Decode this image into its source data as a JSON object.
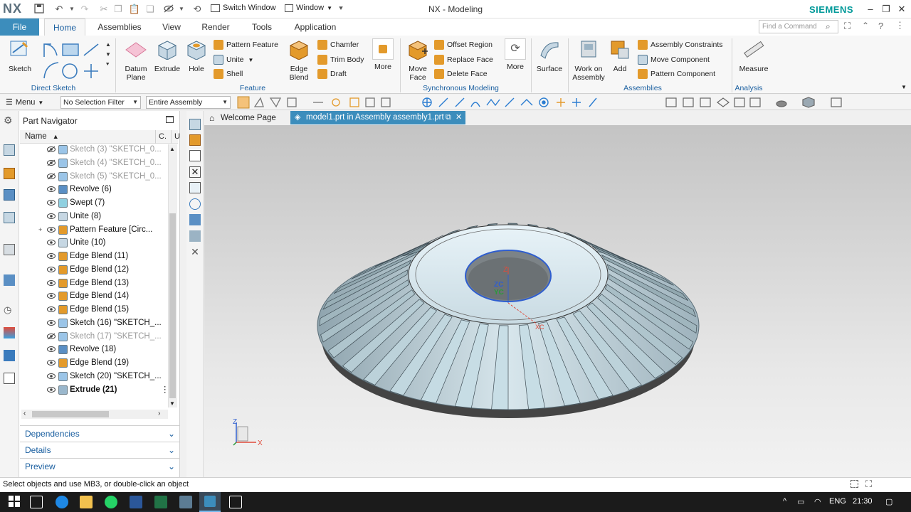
{
  "titlebar": {
    "logo": "NX",
    "switch_window": "Switch Window",
    "window_menu": "Window",
    "app_title": "NX - Modeling",
    "brand": "SIEMENS"
  },
  "ribbon_tabs": [
    "File",
    "Home",
    "Assemblies",
    "View",
    "Render",
    "Tools",
    "Application"
  ],
  "search": {
    "placeholder": "Find a Command"
  },
  "ribbon": {
    "direct_sketch": {
      "label": "Direct Sketch",
      "sketch": "Sketch"
    },
    "feature": {
      "label": "Feature",
      "datum_plane": "Datum Plane",
      "extrude": "Extrude",
      "hole": "Hole",
      "pattern_feature": "Pattern Feature",
      "unite": "Unite",
      "shell": "Shell",
      "edge_blend": "Edge Blend",
      "chamfer": "Chamfer",
      "trim_body": "Trim Body",
      "draft": "Draft",
      "more": "More"
    },
    "sync": {
      "label": "Synchronous Modeling",
      "move_face": "Move Face",
      "offset_region": "Offset Region",
      "replace_face": "Replace Face",
      "delete_face": "Delete Face",
      "more": "More"
    },
    "surface": {
      "label": "Surface"
    },
    "assemblies": {
      "label": "Assemblies",
      "work_on_assembly": "Work on Assembly",
      "add": "Add",
      "assembly_constraints": "Assembly Constraints",
      "move_component": "Move Component",
      "pattern_component": "Pattern Component"
    },
    "analysis": {
      "label": "Analysis",
      "measure": "Measure"
    }
  },
  "selection_bar": {
    "menu": "Menu",
    "filter": "No Selection Filter",
    "scope": "Entire Assembly"
  },
  "navigator": {
    "title": "Part Navigator",
    "col_name": "Name",
    "col_c": "C.",
    "col_u": "U",
    "rows": [
      {
        "label": "Sketch (3) \"SKETCH_0...",
        "type": "sketch",
        "suppressed": true
      },
      {
        "label": "Sketch (4) \"SKETCH_0...",
        "type": "sketch",
        "suppressed": true
      },
      {
        "label": "Sketch (5) \"SKETCH_0...",
        "type": "sketch",
        "suppressed": true
      },
      {
        "label": "Revolve (6)",
        "type": "revolve",
        "suppressed": false
      },
      {
        "label": "Swept (7)",
        "type": "swept",
        "suppressed": false
      },
      {
        "label": "Unite (8)",
        "type": "unite",
        "suppressed": false
      },
      {
        "label": "Pattern Feature [Circ...",
        "type": "pattern",
        "suppressed": false,
        "expandable": true
      },
      {
        "label": "Unite (10)",
        "type": "unite",
        "suppressed": false
      },
      {
        "label": "Edge Blend (11)",
        "type": "blend",
        "suppressed": false
      },
      {
        "label": "Edge Blend (12)",
        "type": "blend",
        "suppressed": false
      },
      {
        "label": "Edge Blend (13)",
        "type": "blend",
        "suppressed": false
      },
      {
        "label": "Edge Blend (14)",
        "type": "blend",
        "suppressed": false
      },
      {
        "label": "Edge Blend (15)",
        "type": "blend",
        "suppressed": false
      },
      {
        "label": "Sketch (16) \"SKETCH_...",
        "type": "sketch",
        "suppressed": false
      },
      {
        "label": "Sketch (17) \"SKETCH_...",
        "type": "sketch",
        "suppressed": true
      },
      {
        "label": "Revolve (18)",
        "type": "revolve",
        "suppressed": false
      },
      {
        "label": "Edge Blend (19)",
        "type": "blend",
        "suppressed": false
      },
      {
        "label": "Sketch (20) \"SKETCH_...",
        "type": "sketch",
        "suppressed": false
      },
      {
        "label": "Extrude (21)",
        "type": "extrude",
        "suppressed": false,
        "bold": true
      }
    ],
    "panels": [
      "Dependencies",
      "Details",
      "Preview"
    ]
  },
  "doc_tabs": {
    "welcome": "Welcome Page",
    "model": "model1.prt in Assembly assembly1.prt"
  },
  "viewport": {
    "triad_labels": {
      "z": "Z",
      "x": "X"
    },
    "wcs_labels": {
      "zc": "ZC",
      "yc": "YC",
      "xc": "XC",
      "z": "Z"
    }
  },
  "status": {
    "text": "Select objects and use MB3, or double-click an object"
  },
  "taskbar": {
    "lang": "ENG",
    "time": "21:30"
  },
  "colors": {
    "accent": "#3c8dbc",
    "brand": "#009999",
    "gear": "#b8cdd6"
  }
}
